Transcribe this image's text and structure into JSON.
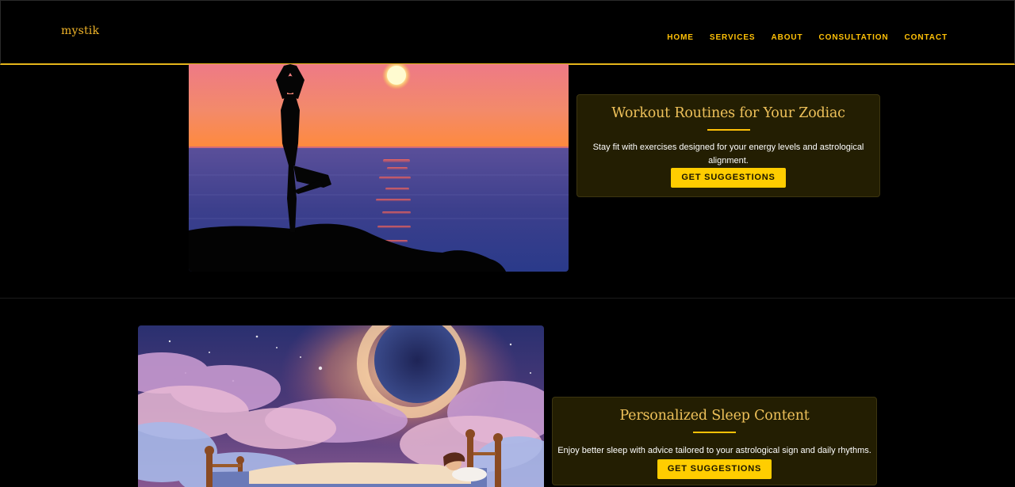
{
  "nav": {
    "brand": "mystik",
    "links": [
      "HOME",
      "SERVICES",
      "ABOUT",
      "CONSULTATION",
      "CONTACT"
    ]
  },
  "sections": [
    {
      "image": "yoga-silhouette-sunset-sea",
      "title": "Workout Routines for Your Zodiac",
      "text": "Stay fit with exercises designed for your energy levels and astrological alignment.",
      "button": "GET SUGGESTIONS"
    },
    {
      "image": "woman-sleeping-in-bed-among-cosmic-clouds",
      "title": "Personalized Sleep Content",
      "text": "Enjoy better sleep with advice tailored to your astrological sign and daily rhythms.",
      "button": "GET SUGGESTIONS"
    }
  ],
  "colors": {
    "accent": "#ffc107",
    "title": "#eec15a",
    "card_bg": "#231e02",
    "background": "#000000"
  }
}
